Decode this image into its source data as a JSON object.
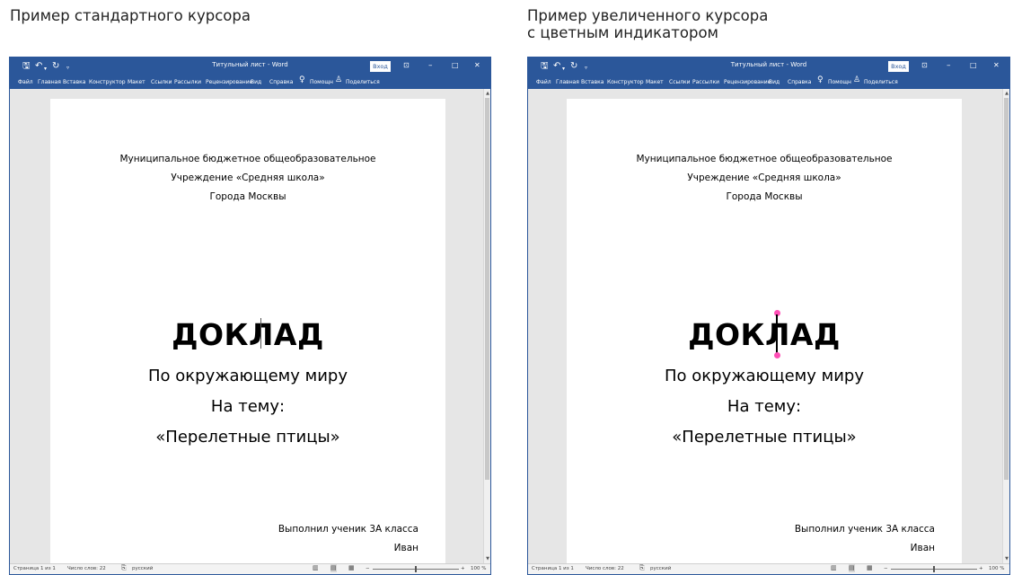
{
  "captions": {
    "left": "Пример стандартного курсора",
    "right_line1": "Пример увеличенного курсора",
    "right_line2": "с цветным индикатором"
  },
  "window": {
    "title": "Титульный лист  -  Word",
    "signin": "Вход",
    "quick_access": {
      "save_icon": "save-icon",
      "undo_icon": "undo-icon",
      "redo_icon": "redo-icon",
      "customize_icon": "customize-icon"
    },
    "controls": {
      "ribbon_options": "ribbon-display-options-icon",
      "minimize": "–",
      "maximize": "□",
      "close": "✕"
    },
    "menu": [
      "Файл",
      "Главная",
      "Вставка",
      "Конструктор",
      "Макет",
      "Ссылки",
      "Рассылки",
      "Рецензирование",
      "Вид",
      "Справка"
    ],
    "tell_me": "Помощн",
    "share": "Поделиться"
  },
  "document": {
    "header_line1": "Муниципальное бюджетное общеобразовательное",
    "header_line2": "Учреждение «Средняя школа»",
    "header_line3": "Города Москвы",
    "title": "ДОКЛАД",
    "subtitle1": "По окружающему миру",
    "subtitle2": "На тему:",
    "subtitle3": "«Перелетные птицы»",
    "sign_line1": "Выполнил ученик 3А класса",
    "sign_line2": "Иван"
  },
  "status": {
    "page": "Страница 1 из 1",
    "words": "Число слов: 22",
    "language": "русский",
    "zoom": "100 %",
    "zoom_minus": "−",
    "zoom_plus": "+"
  },
  "colors": {
    "ribbon": "#2b579a",
    "cursor_indicator": "#ff4fb6"
  }
}
